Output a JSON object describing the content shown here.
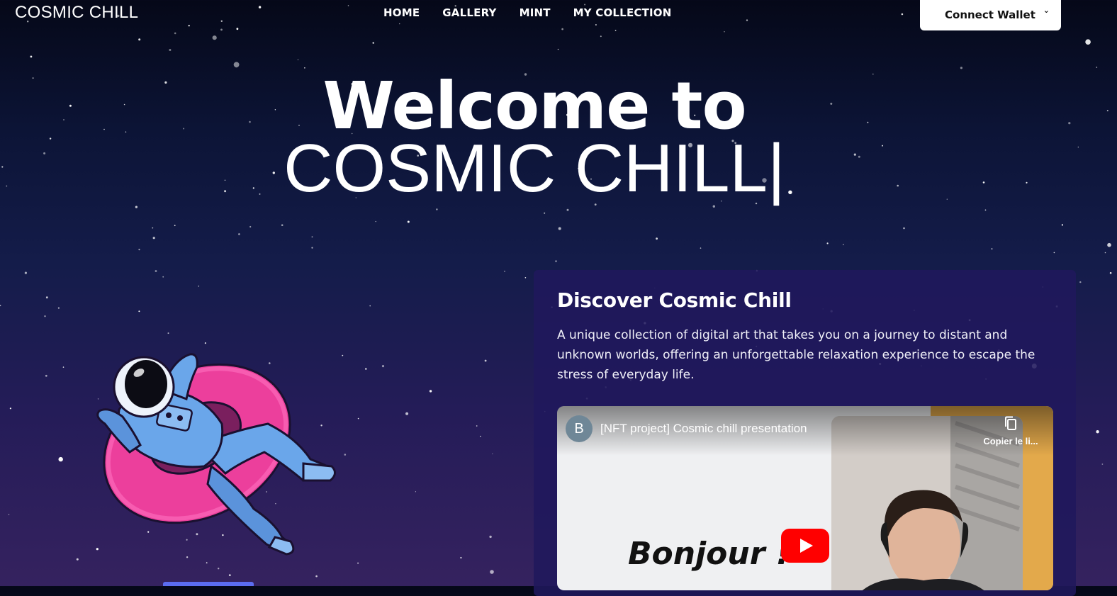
{
  "navbar": {
    "brand": "COSMIC CHILL",
    "links": [
      "HOME",
      "GALLERY",
      "MINT",
      "MY COLLECTION"
    ],
    "wallet_button": "Connect Wallet"
  },
  "hero": {
    "line1": "Welcome to",
    "line2": "COSMIC CHILL|"
  },
  "card": {
    "title": "Discover Cosmic Chill",
    "text": "A unique collection of digital art that takes you on a journey to distant and unknown worlds, offering an unforgettable relaxation experience to escape the stress of everyday life."
  },
  "video": {
    "channel_initial": "B",
    "title": "[NFT project] Cosmic chill presentation",
    "copy_label": "Copier le li...",
    "thumbnail_text": "Bonjour !"
  },
  "icons": {
    "wallet_chevron": "chevron-down-icon",
    "copy": "copy-link-icon",
    "play": "youtube-play-icon"
  },
  "colors": {
    "background_top": "#050818",
    "background_bottom": "#35225f",
    "card": "#20185c",
    "donut": "#ec3f9c",
    "astronaut_suit": "#6aa6ea",
    "youtube_red": "#ff0000",
    "video_yellow": "#e3a94b"
  }
}
